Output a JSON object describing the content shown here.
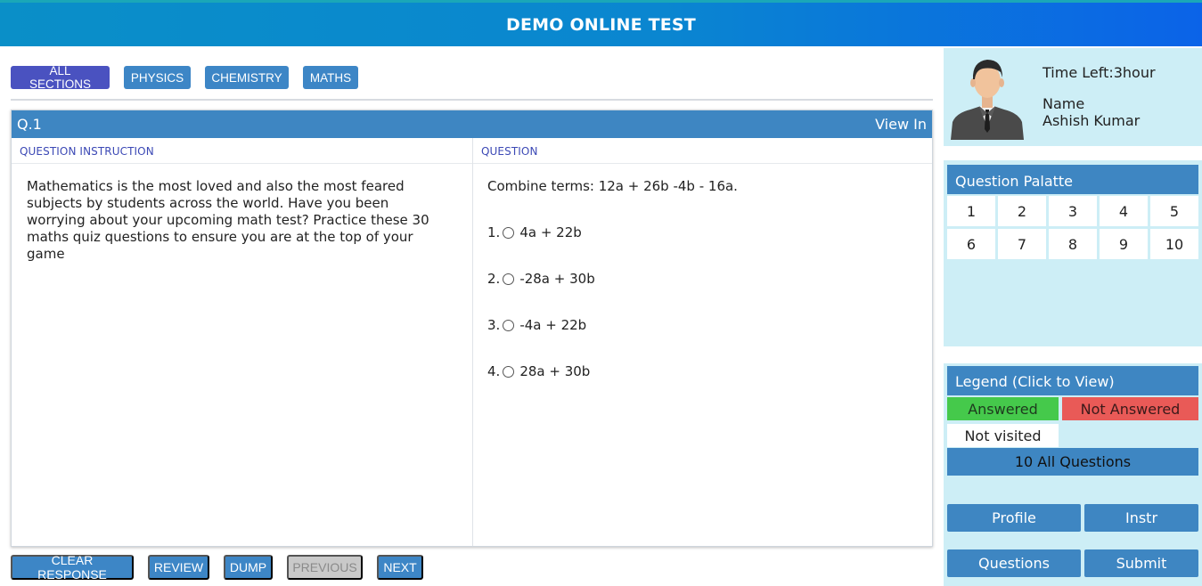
{
  "header": {
    "title": "DEMO ONLINE TEST"
  },
  "sections": [
    {
      "label": "ALL SECTIONS"
    },
    {
      "label": "PHYSICS"
    },
    {
      "label": "CHEMISTRY"
    },
    {
      "label": "MATHS"
    }
  ],
  "question": {
    "number": "Q.1",
    "view_in": "View In",
    "instruction_heading": "QUESTION INSTRUCTION",
    "question_heading": "QUESTION",
    "instruction_text": "Mathematics is the most loved and also the most feared subjects by students across the world. Have you been worrying about your upcoming math test? Practice these 30 maths quiz questions to ensure you are at the top of your game",
    "text": "Combine terms: 12a + 26b -4b - 16a.",
    "options": [
      {
        "num": "1.",
        "text": "4a + 22b"
      },
      {
        "num": "2.",
        "text": "-28a + 30b"
      },
      {
        "num": "3.",
        "text": "-4a + 22b"
      },
      {
        "num": "4.",
        "text": "28a + 30b"
      }
    ]
  },
  "footer_buttons": {
    "clear": "CLEAR RESPONSE",
    "review": "REVIEW",
    "dump": "DUMP",
    "previous": "PREVIOUS",
    "next": "NEXT"
  },
  "profile": {
    "time_left": "Time Left:3hour",
    "name_label": "Name",
    "name": "Ashish Kumar"
  },
  "palette": {
    "title": "Question Palatte",
    "numbers": [
      "1",
      "2",
      "3",
      "4",
      "5",
      "6",
      "7",
      "8",
      "9",
      "10"
    ]
  },
  "legend": {
    "title": "Legend (Click to View)",
    "answered": "Answered",
    "not_answered": "Not Answered",
    "not_visited": "Not visited",
    "all_questions": "10 All Questions"
  },
  "side_buttons": {
    "profile": "Profile",
    "instr": "Instr",
    "questions": "Questions",
    "submit": "Submit"
  },
  "colors": {
    "primary": "#3e86c2",
    "active_tab": "#4a52c0",
    "side_bg": "#cdeef6",
    "answered": "#45c94b",
    "not_answered": "#e95a57"
  }
}
